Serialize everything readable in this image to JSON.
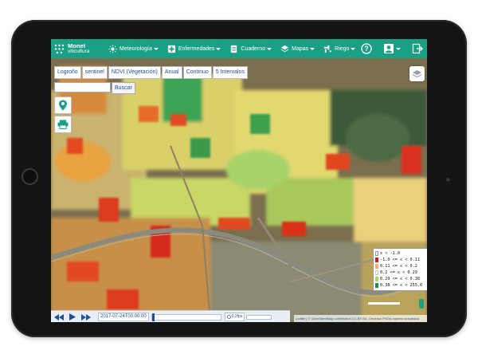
{
  "brand": {
    "line1": "Monet",
    "line2": "viticultura"
  },
  "nav": {
    "items": [
      {
        "label": "Meteorología",
        "icon": "sun-icon"
      },
      {
        "label": "Enfermedades",
        "icon": "medical-cross-icon"
      },
      {
        "label": "Cuaderno",
        "icon": "notebook-icon"
      },
      {
        "label": "Mapas",
        "icon": "layers-icon"
      },
      {
        "label": "Riego",
        "icon": "irrigation-icon"
      }
    ],
    "right_icons": [
      "help-icon",
      "user-icon",
      "exit-icon"
    ]
  },
  "filters": [
    "Logroño",
    "sentinel",
    "NDVI (Vegetación)",
    "Anual",
    "Continuo",
    "5 Intervalos"
  ],
  "search": {
    "placeholder": "",
    "button": "Buscar"
  },
  "legend": [
    {
      "label": "x < -1.0",
      "color": "#ffffff"
    },
    {
      "label": "-1.0 <= x < 0.11",
      "color": "#d7191c"
    },
    {
      "label": "0.11 <= x < 0.2",
      "color": "#fdae61"
    },
    {
      "label": "0.2 <= x < 0.29",
      "color": "#ffffbf"
    },
    {
      "label": "0.29 <= x < 0.38",
      "color": "#a6d96a"
    },
    {
      "label": "0.38 <= x < 255.0",
      "color": "#1a9641"
    }
  ],
  "player": {
    "time": "2017-07-24T00:00:00",
    "speed": "0.2fps"
  },
  "attribution": "Leaflet | © OpenStreetMap contributors CC-BY-SA, Ortofotos PNOA máxima actualidad",
  "colors": {
    "accent": "#1aa085",
    "link": "#1f4f9a"
  }
}
